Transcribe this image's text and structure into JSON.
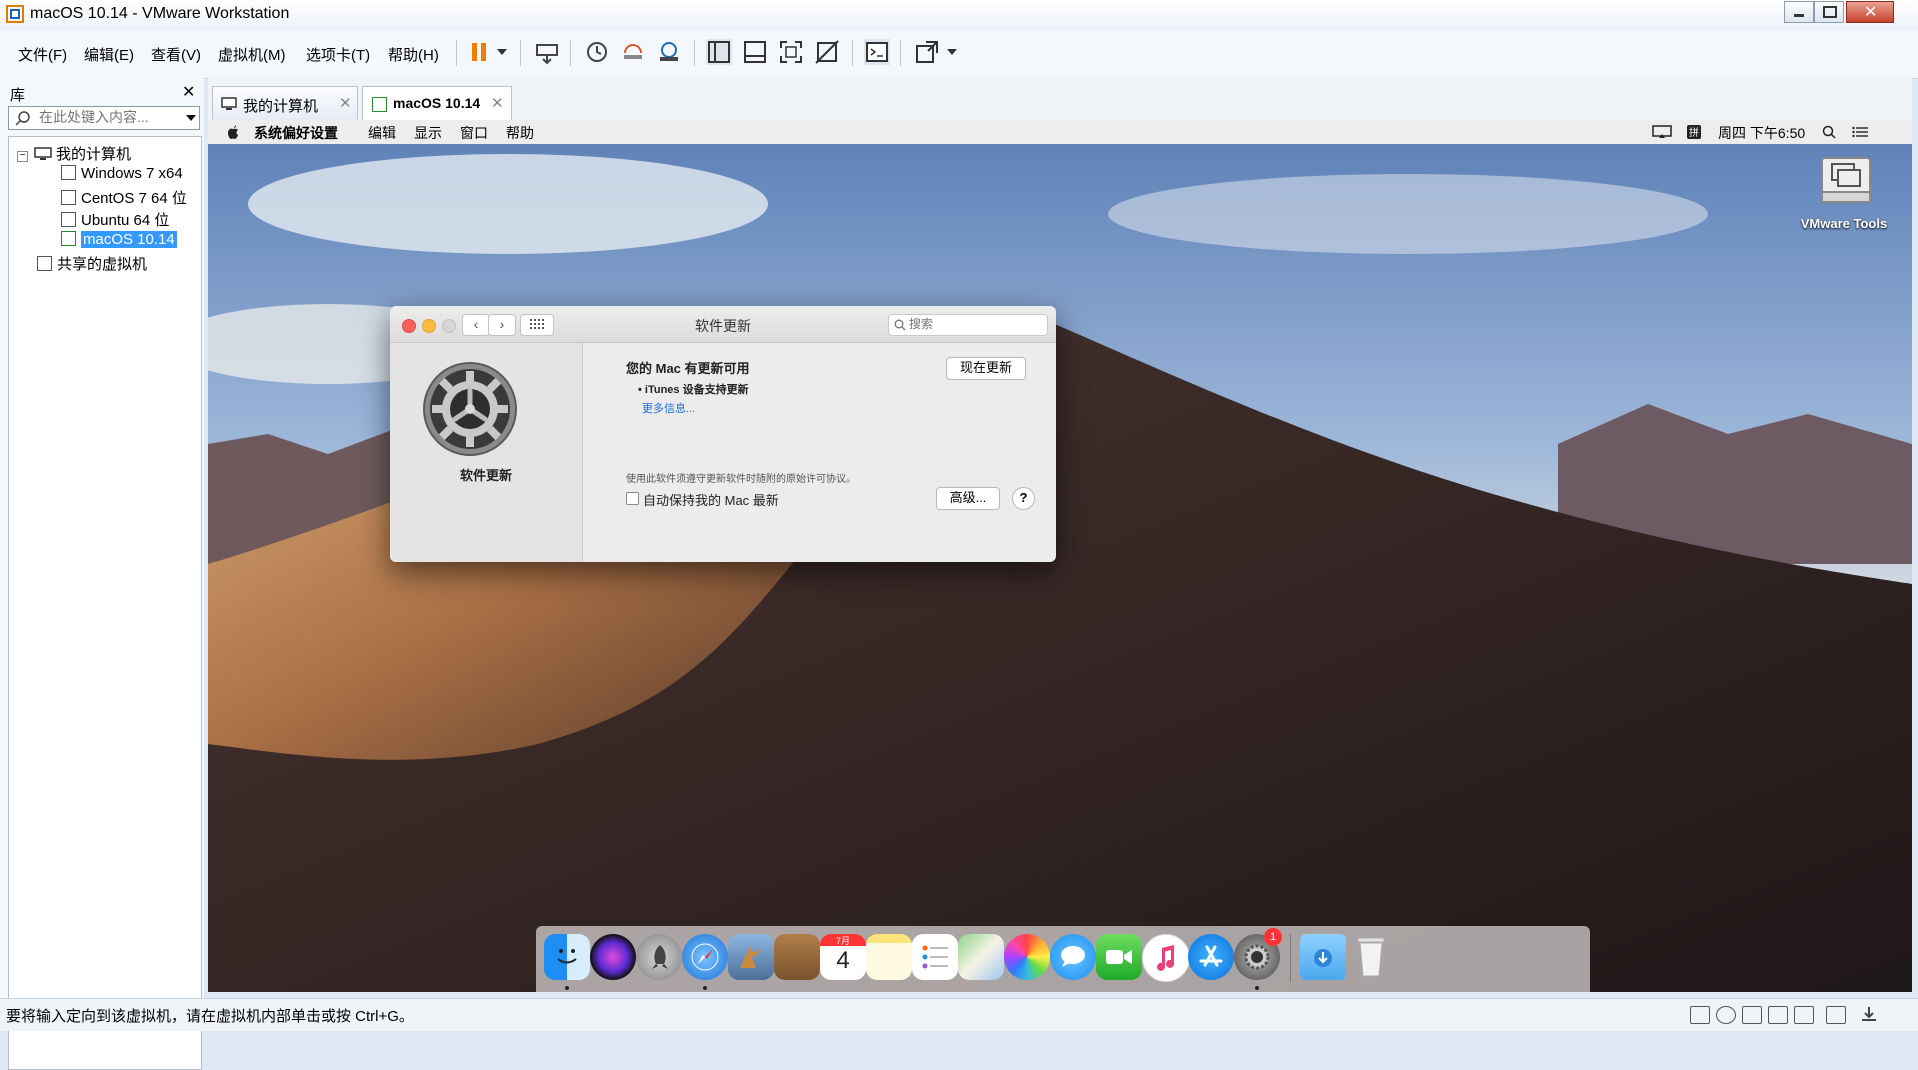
{
  "window": {
    "title": "macOS 10.14 - VMware Workstation"
  },
  "menubar": {
    "items": [
      "文件(F)",
      "编辑(E)",
      "查看(V)",
      "虚拟机(M)",
      "选项卡(T)",
      "帮助(H)"
    ]
  },
  "toolbar": {
    "icons": [
      "pause-icon",
      "dropdown-arrow-icon",
      "send-ctrl-alt-del-icon",
      "snapshot-icon",
      "revert-snapshot-icon",
      "snapshot-manager-icon",
      "show-library-icon",
      "thumbnail-bar-icon",
      "full-screen-icon",
      "unity-icon",
      "console-view-icon",
      "stretch-icon"
    ]
  },
  "library": {
    "title": "库",
    "search_placeholder": "在此处键入内容...",
    "tree": {
      "root": "我的计算机",
      "vms": [
        "Windows 7 x64",
        "CentOS 7 64 位",
        "Ubuntu 64 位",
        "macOS 10.14"
      ],
      "selected": "macOS 10.14",
      "shared": "共享的虚拟机"
    }
  },
  "tabs": [
    {
      "label": "我的计算机",
      "active": false
    },
    {
      "label": "macOS 10.14",
      "active": true
    }
  ],
  "mac": {
    "menu": [
      "系统偏好设置",
      "编辑",
      "显示",
      "窗口",
      "帮助"
    ],
    "clock": "周四 下午6:50",
    "desktop_icon_label": "VMware Tools",
    "dialog": {
      "title": "软件更新",
      "search_placeholder": "搜索",
      "pane_label": "软件更新",
      "heading": "您的 Mac 有更新可用",
      "update_item": "• iTunes 设备支持更新",
      "more_info": "更多信息...",
      "update_now": "现在更新",
      "license": "使用此软件须遵守更新软件时随附的原始许可协议。",
      "auto_update": "自动保持我的 Mac 最新",
      "advanced": "高级...",
      "help": "?"
    },
    "dock": {
      "calendar_month": "7月",
      "calendar_day": "4",
      "settings_badge": "1"
    }
  },
  "status": {
    "message": "要将输入定向到该虚拟机，请在虚拟机内部单击或按 Ctrl+G。"
  },
  "colors": {
    "accent": "#3399ff",
    "close_red": "#fc605c",
    "min_yellow": "#fdbc40",
    "mac_link": "#1a6ed8"
  }
}
